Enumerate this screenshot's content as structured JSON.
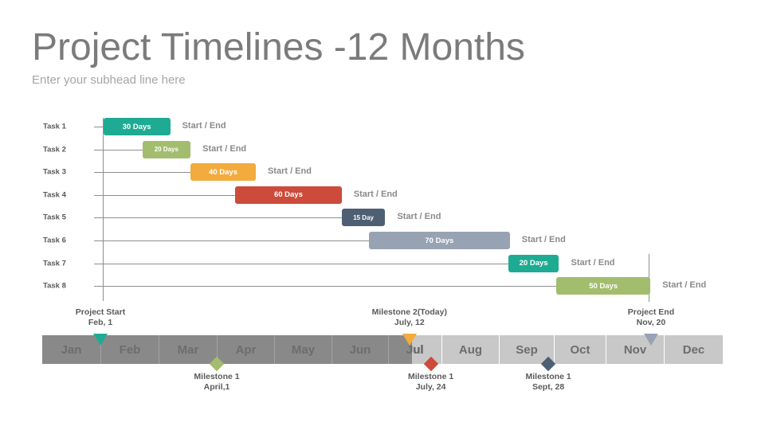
{
  "header": {
    "title": "Project Timelines -12 Months",
    "subhead": "Enter your subhead line here"
  },
  "colors": {
    "teal": "#1fab93",
    "green": "#a2bd6d",
    "orange": "#f2ab3c",
    "red": "#cc4b3b",
    "slate": "#4f5f73",
    "bluegray": "#97a3b3",
    "elapsed": "#898989",
    "remaining": "#c8c8c8"
  },
  "chart_data": {
    "type": "gantt",
    "title": "Project Timelines -12 Months",
    "subtitle": "Enter your subhead line here",
    "x_unit": "month",
    "xlim": [
      0,
      12
    ],
    "months": [
      "Jan",
      "Feb",
      "Mar",
      "Apr",
      "May",
      "Jun",
      "Jul",
      "Aug",
      "Sep",
      "Oct",
      "Nov",
      "Dec"
    ],
    "today_position": 6.45,
    "tasks": [
      {
        "name": "Task 1",
        "duration_label": "30 Days",
        "start": 1.05,
        "end": 2.2,
        "color": "#1fab93",
        "note": "Start / End",
        "small": false
      },
      {
        "name": "Task 2",
        "duration_label": "20 Days",
        "start": 1.72,
        "end": 2.55,
        "color": "#a2bd6d",
        "note": "Start / End",
        "small": true
      },
      {
        "name": "Task 3",
        "duration_label": "40 Days",
        "start": 2.55,
        "end": 3.68,
        "color": "#f2ab3c",
        "note": "Start / End",
        "small": false
      },
      {
        "name": "Task 4",
        "duration_label": "60 Days",
        "start": 3.32,
        "end": 5.18,
        "color": "#cc4b3b",
        "note": "Start / End",
        "small": false
      },
      {
        "name": "Task 5",
        "duration_label": "15 Day",
        "start": 5.18,
        "end": 5.95,
        "color": "#4f5f73",
        "note": "Start / End",
        "small": true
      },
      {
        "name": "Task 6",
        "duration_label": "70 Days",
        "start": 5.66,
        "end": 8.2,
        "color": "#97a3b3",
        "note": "Start / End",
        "small": false
      },
      {
        "name": "Task 7",
        "duration_label": "20 Days",
        "start": 8.17,
        "end": 9.1,
        "color": "#1fab93",
        "note": "Start / End",
        "small": false
      },
      {
        "name": "Task 8",
        "duration_label": "50 Days",
        "start": 9.05,
        "end": 10.77,
        "color": "#a2bd6d",
        "note": "Start / End",
        "small": false
      }
    ],
    "milestones_above": [
      {
        "title": "Project Start",
        "date": "Feb, 1",
        "position": 1.0,
        "color": "#1fab93",
        "shape": "triangle"
      },
      {
        "title": "Milestone 2(Today)",
        "date": "July, 12",
        "position": 6.4,
        "color": "#f2ab3c",
        "shape": "triangle"
      },
      {
        "title": "Project End",
        "date": "Nov, 20",
        "position": 10.78,
        "color": "#97a3b3",
        "shape": "triangle"
      }
    ],
    "milestones_below": [
      {
        "title": "Milestone 1",
        "date": "April,1",
        "position": 3.0,
        "color": "#a2bd6d",
        "shape": "diamond"
      },
      {
        "title": "Milestone 1",
        "date": "July, 24",
        "position": 6.8,
        "color": "#cc4b3b",
        "shape": "diamond"
      },
      {
        "title": "Milestone 1",
        "date": "Sept, 28",
        "position": 8.9,
        "color": "#4f5f73",
        "shape": "diamond"
      }
    ]
  }
}
